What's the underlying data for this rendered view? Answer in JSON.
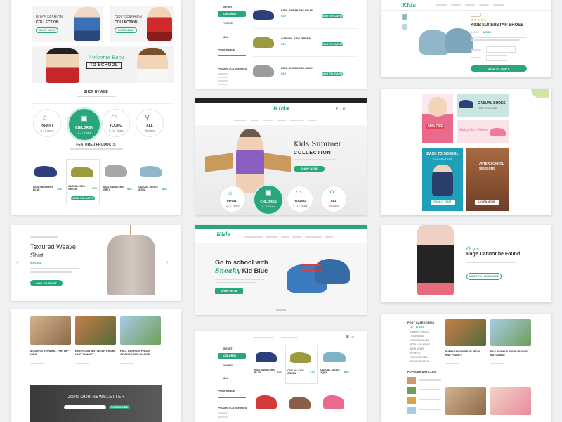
{
  "colors": {
    "accent": "#2aa67f",
    "sale": "#e9445a",
    "sky": "#3d7bbf"
  },
  "card1": {
    "boys_title": "BOY'S FASHION",
    "boys_sub": "COLLECTION",
    "boys_btn": "SHOP NOW",
    "girls_title": "GIRL'S FASHION",
    "girls_sub": "COLLECTION",
    "girls_btn": "SHOP NOW",
    "welcome": "Welcome Back",
    "to_school": "TO SCHOOL",
    "shop_by_age": "SHOP BY AGE",
    "ages": [
      {
        "label": "INFANT",
        "range": "0 - 1 Years"
      },
      {
        "label": "CHILDREN",
        "range": "1 - 7 Years"
      },
      {
        "label": "YOUNG",
        "range": "7 - 12 Years"
      },
      {
        "label": "ALL",
        "range": "All Ages"
      }
    ],
    "featured": "FEATURED PRODUCTS",
    "products": [
      {
        "name": "KIDS SNEAKERS BLUE",
        "price": "$25"
      },
      {
        "name": "CASUAL KIDS GREEN",
        "price": "$25"
      },
      {
        "name": "KIDS SNEAKERS GREY",
        "price": "$25"
      },
      {
        "name": "CASUAL SHOES AQUA",
        "price": "$25"
      }
    ],
    "add_to_cart": "ADD TO CART"
  },
  "card2": {
    "filters": [
      "INFANT",
      "CHILDREN",
      "YOUNG",
      "ALL"
    ],
    "price_range": "PRICE RANGE",
    "product_categories": "PRODUCT CATEGORIES",
    "items": [
      {
        "name": "KIDS SNEAKERS BLUE",
        "price": "$25"
      },
      {
        "name": "CASUAL KIDS GREEN",
        "price": "$25"
      },
      {
        "name": "KIDS SNEAKERS GRAY",
        "price": "$25"
      }
    ],
    "add_to_cart": "ADD TO CART"
  },
  "card3": {
    "logo": "Kids",
    "product_title": "KIDS SUPERSTAR SHOES",
    "old_price": "$40.00",
    "price": "$25.00",
    "add_to_cart": "ADD TO CART"
  },
  "card4": {
    "logo": "Kids",
    "headline1": "Kids Summer",
    "headline2": "COLLECTION",
    "shop_now": "SHOP NOW",
    "ages": [
      {
        "label": "INFANT",
        "range": "0 - 1 Years"
      },
      {
        "label": "CHILDREN",
        "range": "1 - 7 Years"
      },
      {
        "label": "YOUNG",
        "range": "7 - 12 Years"
      },
      {
        "label": "ALL",
        "range": "All Ages"
      }
    ]
  },
  "card5": {
    "casual": "CASUAL SHOES",
    "free_ship": "FREE SHIPPING",
    "off": "50% OFF",
    "baby_girl": "Baby Girl Shoes",
    "back_to_school": "BACK TO SCHOOL",
    "collection": "COLLECTION",
    "after_school": "AFTER SCHOOL",
    "sessions": "SESSIONS",
    "grab": "GRAB IT FIRST",
    "learn": "LEARN MORE"
  },
  "card6": {
    "t1": "Textured Weave",
    "t2": "Shirt",
    "price": "$25.00",
    "add_to_cart": "ADD TO CART"
  },
  "card7": {
    "logo": "Kids",
    "headline1": "Go to school with",
    "sneaky": "Sneaky",
    "kid_blue": "Kid Blue",
    "shop_now": "SHOP NOW"
  },
  "card8": {
    "oops": "Oops...",
    "not_found": "Page Cannot be Found",
    "back_btn": "BACK TO HOMEPAGE"
  },
  "card9": {
    "posts": [
      {
        "title": "MODERN APPAREL FOR HIP KIDS"
      },
      {
        "title": "EVERYDAY ANYWEAR FROM KNIT PLANET"
      },
      {
        "title": "FALL FASHION FROM ORANGE MAYONAISE"
      }
    ],
    "newsletter": "JOIN OUR NEWSLETTER",
    "subscribe": "SUBSCRIBE"
  },
  "card10": {
    "filters": [
      "INFANT",
      "CHILDREN",
      "YOUNG",
      "ALL"
    ],
    "price_range": "PRICE RANGE",
    "product_categories": "PRODUCT CATEGORIES",
    "grid_items": [
      {
        "name": "KIDS SNEAKERS BLUE",
        "price": "$25"
      },
      {
        "name": "CASUAL KIDS GREEN",
        "price": "$25"
      },
      {
        "name": "CASUAL SHOES AQUA",
        "price": "$25"
      }
    ]
  },
  "card11": {
    "post_categories": "POST CATEGORIES",
    "categories": [
      "ALL POSTS",
      "FAMILY TRICKS",
      "TRAVELING",
      "FASHION GUIDE",
      "POPULAR NEWS",
      "KIDS NEWS",
      "SPORTS",
      "FASHION KIDS",
      "FASHION ITEMS"
    ],
    "popular_articles": "POPULAR ARTICLES",
    "posts": [
      {
        "title": "EVERYDAY ANYWEAR FROM KNIT PLANET"
      },
      {
        "title": "FALL FASHION FROM ORANGE MAYONAISE"
      }
    ]
  }
}
